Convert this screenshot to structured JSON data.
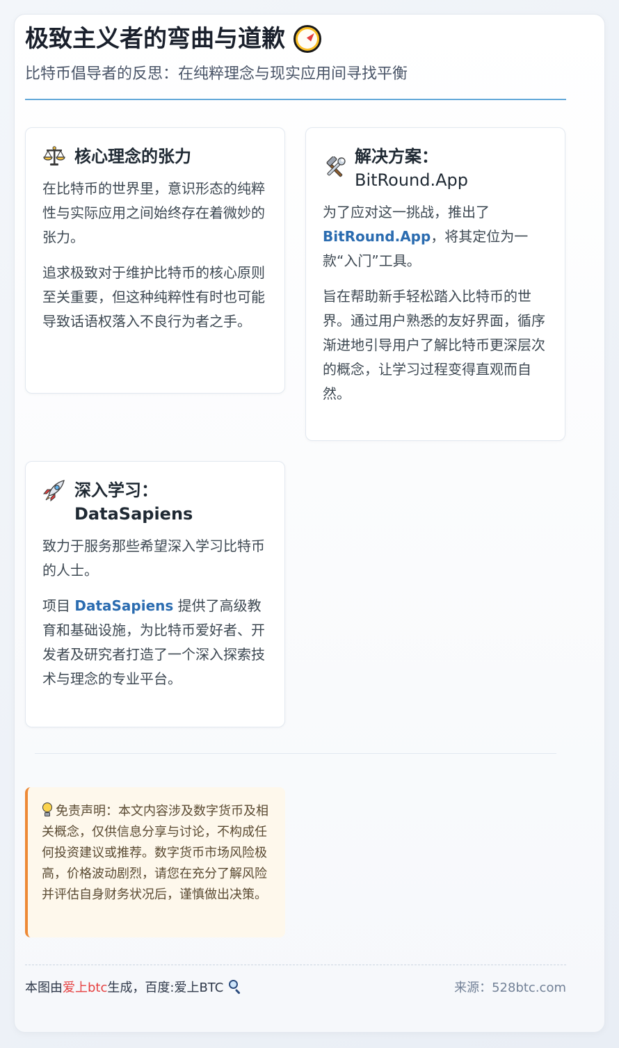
{
  "header": {
    "title": "极致主义者的弯曲与道歉",
    "title_icon": "compass-icon",
    "subtitle": "比特币倡导者的反思：在纯粹理念与现实应用间寻找平衡"
  },
  "cards": [
    {
      "icon": "balance-scale-icon",
      "title": "核心理念的张力",
      "paragraphs": [
        "在比特币的世界里，意识形态的纯粹性与实际应用之间始终存在着微妙的张力。",
        "追求极致对于维护比特币的核心原则至关重要，但这种纯粹性有时也可能导致话语权落入不良行为者之手。"
      ]
    },
    {
      "icon": "hammer-and-wrench-icon",
      "title": "解决方案：",
      "title_line2": "BitRound.App",
      "p1_before": "为了应对这一挑战，推出了",
      "p1_link": "BitRound.App",
      "p1_after": "，将其定位为一款“入门”工具。",
      "p2": "旨在帮助新手轻松踏入比特币的世界。通过用户熟悉的友好界面，循序渐进地引导用户了解比特币更深层次的概念，让学习过程变得直观而自然。"
    },
    {
      "icon": "rocket-icon",
      "title": "深入学习：DataSapiens",
      "p1": "致力于服务那些希望深入学习比特币的人士。",
      "p2_before": "项目 ",
      "p2_link": "DataSapiens",
      "p2_after": " 提供了高级教育和基础设施，为比特币爱好者、开发者及研究者打造了一个深入探索技术与理念的专业平台。"
    }
  ],
  "disclaimer": {
    "icon": "light-bulb-icon",
    "text": "免责声明：本文内容涉及数字货币及相关概念，仅供信息分享与讨论，不构成任何投资建议或推荐。数字货币市场风险极高，价格波动剧烈，请您在充分了解风险并评估自身财务状况后，谨慎做出决策。"
  },
  "footer": {
    "prefix": "本图由",
    "brand": "爱上btc",
    "middle": "生成，百度:爱上BTC",
    "search_icon": "magnifying-glass-icon",
    "source": "来源：528btc.com"
  },
  "colors": {
    "accent_rule": "#63a8d9",
    "link": "#2b6cb0",
    "disclaimer_border": "#ed8936",
    "disclaimer_bg": "#fef8ec",
    "brand_red": "#e53e3e"
  }
}
